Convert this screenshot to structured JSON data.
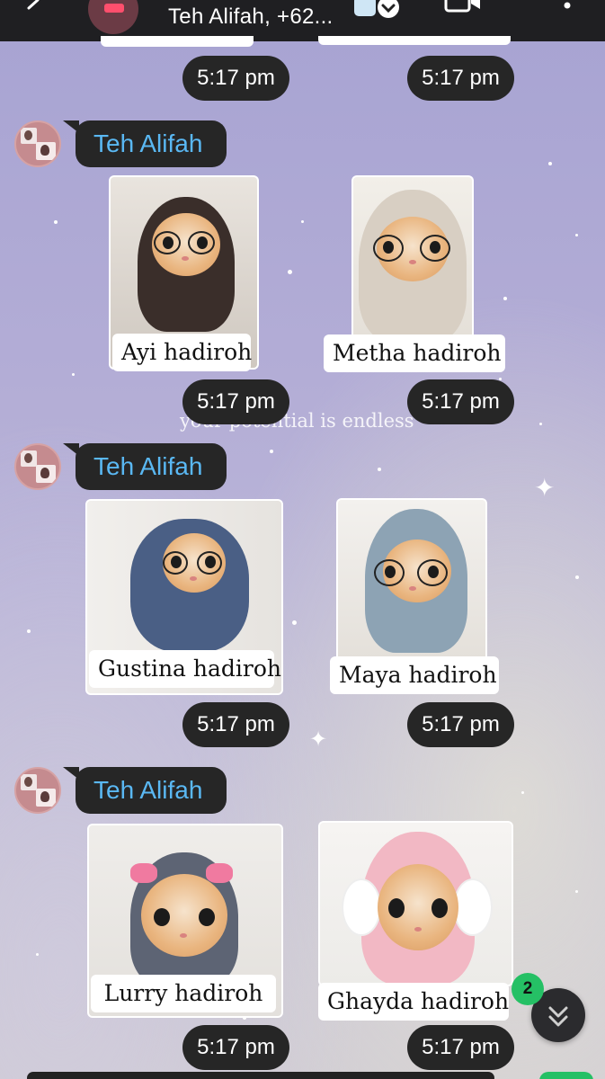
{
  "header": {
    "title": "Teh Alifah, +62...",
    "back_icon": "arrow-back-icon",
    "sticker_icon": "sticker-dropdown-icon",
    "video_icon": "video-call-icon",
    "menu_icon": "more-vertical-icon"
  },
  "colors": {
    "header_bg": "#1f1f22",
    "bubble_bg": "#262626",
    "sender_name": "#5ab8f3",
    "badge_green": "#25c065"
  },
  "wallpaper_text": "your potential is endless",
  "top_timestamps": [
    "5:17 pm",
    "5:17 pm"
  ],
  "groups": [
    {
      "sender": "Teh Alifah",
      "stickers": [
        {
          "caption": "Ayi hadiroh",
          "time": "5:17 pm"
        },
        {
          "caption": "Metha hadiroh",
          "time": "5:17 pm"
        }
      ]
    },
    {
      "sender": "Teh Alifah",
      "stickers": [
        {
          "caption": "Gustina hadiroh",
          "time": "5:17 pm"
        },
        {
          "caption": "Maya hadiroh",
          "time": "5:17 pm"
        }
      ]
    },
    {
      "sender": "Teh Alifah",
      "stickers": [
        {
          "caption": "Lurry hadiroh",
          "time": "5:17 pm"
        },
        {
          "caption": "Ghayda hadiroh",
          "time": "5:17 pm"
        }
      ]
    }
  ],
  "scroll_down": {
    "icon": "double-chevron-down-icon",
    "unread_count": "2"
  }
}
